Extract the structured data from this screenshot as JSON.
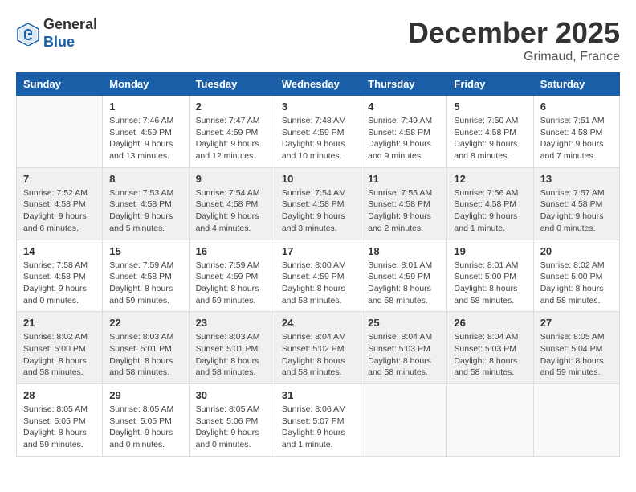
{
  "header": {
    "logo_general": "General",
    "logo_blue": "Blue",
    "month_title": "December 2025",
    "subtitle": "Grimaud, France"
  },
  "days_of_week": [
    "Sunday",
    "Monday",
    "Tuesday",
    "Wednesday",
    "Thursday",
    "Friday",
    "Saturday"
  ],
  "weeks": [
    [
      {
        "day": "",
        "info": ""
      },
      {
        "day": "1",
        "info": "Sunrise: 7:46 AM\nSunset: 4:59 PM\nDaylight: 9 hours\nand 13 minutes."
      },
      {
        "day": "2",
        "info": "Sunrise: 7:47 AM\nSunset: 4:59 PM\nDaylight: 9 hours\nand 12 minutes."
      },
      {
        "day": "3",
        "info": "Sunrise: 7:48 AM\nSunset: 4:59 PM\nDaylight: 9 hours\nand 10 minutes."
      },
      {
        "day": "4",
        "info": "Sunrise: 7:49 AM\nSunset: 4:58 PM\nDaylight: 9 hours\nand 9 minutes."
      },
      {
        "day": "5",
        "info": "Sunrise: 7:50 AM\nSunset: 4:58 PM\nDaylight: 9 hours\nand 8 minutes."
      },
      {
        "day": "6",
        "info": "Sunrise: 7:51 AM\nSunset: 4:58 PM\nDaylight: 9 hours\nand 7 minutes."
      }
    ],
    [
      {
        "day": "7",
        "info": "Sunrise: 7:52 AM\nSunset: 4:58 PM\nDaylight: 9 hours\nand 6 minutes."
      },
      {
        "day": "8",
        "info": "Sunrise: 7:53 AM\nSunset: 4:58 PM\nDaylight: 9 hours\nand 5 minutes."
      },
      {
        "day": "9",
        "info": "Sunrise: 7:54 AM\nSunset: 4:58 PM\nDaylight: 9 hours\nand 4 minutes."
      },
      {
        "day": "10",
        "info": "Sunrise: 7:54 AM\nSunset: 4:58 PM\nDaylight: 9 hours\nand 3 minutes."
      },
      {
        "day": "11",
        "info": "Sunrise: 7:55 AM\nSunset: 4:58 PM\nDaylight: 9 hours\nand 2 minutes."
      },
      {
        "day": "12",
        "info": "Sunrise: 7:56 AM\nSunset: 4:58 PM\nDaylight: 9 hours\nand 1 minute."
      },
      {
        "day": "13",
        "info": "Sunrise: 7:57 AM\nSunset: 4:58 PM\nDaylight: 9 hours\nand 0 minutes."
      }
    ],
    [
      {
        "day": "14",
        "info": "Sunrise: 7:58 AM\nSunset: 4:58 PM\nDaylight: 9 hours\nand 0 minutes."
      },
      {
        "day": "15",
        "info": "Sunrise: 7:59 AM\nSunset: 4:58 PM\nDaylight: 8 hours\nand 59 minutes."
      },
      {
        "day": "16",
        "info": "Sunrise: 7:59 AM\nSunset: 4:59 PM\nDaylight: 8 hours\nand 59 minutes."
      },
      {
        "day": "17",
        "info": "Sunrise: 8:00 AM\nSunset: 4:59 PM\nDaylight: 8 hours\nand 58 minutes."
      },
      {
        "day": "18",
        "info": "Sunrise: 8:01 AM\nSunset: 4:59 PM\nDaylight: 8 hours\nand 58 minutes."
      },
      {
        "day": "19",
        "info": "Sunrise: 8:01 AM\nSunset: 5:00 PM\nDaylight: 8 hours\nand 58 minutes."
      },
      {
        "day": "20",
        "info": "Sunrise: 8:02 AM\nSunset: 5:00 PM\nDaylight: 8 hours\nand 58 minutes."
      }
    ],
    [
      {
        "day": "21",
        "info": "Sunrise: 8:02 AM\nSunset: 5:00 PM\nDaylight: 8 hours\nand 58 minutes."
      },
      {
        "day": "22",
        "info": "Sunrise: 8:03 AM\nSunset: 5:01 PM\nDaylight: 8 hours\nand 58 minutes."
      },
      {
        "day": "23",
        "info": "Sunrise: 8:03 AM\nSunset: 5:01 PM\nDaylight: 8 hours\nand 58 minutes."
      },
      {
        "day": "24",
        "info": "Sunrise: 8:04 AM\nSunset: 5:02 PM\nDaylight: 8 hours\nand 58 minutes."
      },
      {
        "day": "25",
        "info": "Sunrise: 8:04 AM\nSunset: 5:03 PM\nDaylight: 8 hours\nand 58 minutes."
      },
      {
        "day": "26",
        "info": "Sunrise: 8:04 AM\nSunset: 5:03 PM\nDaylight: 8 hours\nand 58 minutes."
      },
      {
        "day": "27",
        "info": "Sunrise: 8:05 AM\nSunset: 5:04 PM\nDaylight: 8 hours\nand 59 minutes."
      }
    ],
    [
      {
        "day": "28",
        "info": "Sunrise: 8:05 AM\nSunset: 5:05 PM\nDaylight: 8 hours\nand 59 minutes."
      },
      {
        "day": "29",
        "info": "Sunrise: 8:05 AM\nSunset: 5:05 PM\nDaylight: 9 hours\nand 0 minutes."
      },
      {
        "day": "30",
        "info": "Sunrise: 8:05 AM\nSunset: 5:06 PM\nDaylight: 9 hours\nand 0 minutes."
      },
      {
        "day": "31",
        "info": "Sunrise: 8:06 AM\nSunset: 5:07 PM\nDaylight: 9 hours\nand 1 minute."
      },
      {
        "day": "",
        "info": ""
      },
      {
        "day": "",
        "info": ""
      },
      {
        "day": "",
        "info": ""
      }
    ]
  ]
}
